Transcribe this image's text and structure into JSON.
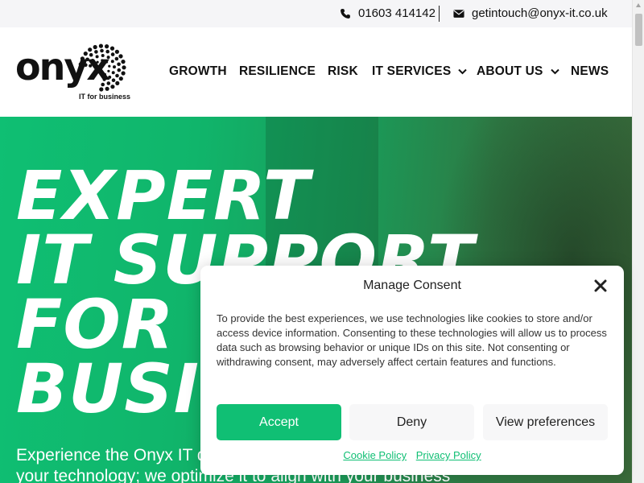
{
  "topbar": {
    "phone_icon": "phone-icon",
    "phone": "01603 414142",
    "email_icon": "envelope-icon",
    "email": "getintouch@onyx-it.co.uk"
  },
  "logo": {
    "word": "onyx",
    "tagline": "IT for business"
  },
  "nav": {
    "items": [
      {
        "label": "GROWTH"
      },
      {
        "label": "RESILIENCE"
      },
      {
        "label": "RISK"
      },
      {
        "label": "IT SERVICES",
        "icon": "chevron-down-icon"
      },
      {
        "label": "ABOUT US",
        "icon": "chevron-down-icon"
      },
      {
        "label": "NEWS"
      }
    ]
  },
  "hero": {
    "title_lines": [
      "EXPERT",
      "IT SUPPORT",
      "FOR YOUR",
      "BUSINESS"
    ],
    "subtitle_lines": [
      "Experience the Onyx IT difference. We don't just manage",
      "your technology; we optimize it to align with your business"
    ]
  },
  "consent": {
    "title": "Manage Consent",
    "close_icon": "close-icon",
    "body": "To provide the best experiences, we use technologies like cookies to store and/or access device information. Consenting to these technologies will allow us to process data such as browsing behavior or unique IDs on this site. Not consenting or withdrawing consent, may adversely affect certain features and functions.",
    "accept_label": "Accept",
    "deny_label": "Deny",
    "view_label": "View preferences",
    "cookie_policy": "Cookie Policy",
    "privacy_policy": "Privacy Policy"
  },
  "colors": {
    "brand_green": "#10bf74",
    "text_dark": "#111111"
  }
}
